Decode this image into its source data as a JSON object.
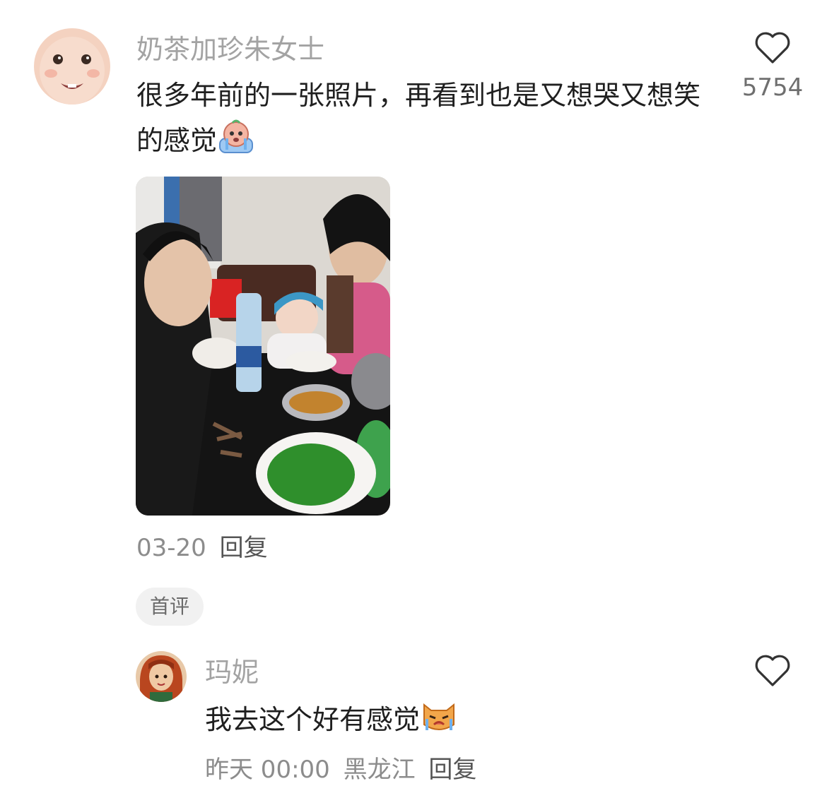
{
  "comment1": {
    "username": "奶茶加珍朱女士",
    "text": "很多年前的一张照片，再看到也是又想哭又想笑的感觉",
    "emoji": "crying-face-emoji",
    "like_count": "5754",
    "date": "03-20",
    "reply_label": "回复",
    "photo": "family-dinner-photo"
  },
  "badge": {
    "label": "首评"
  },
  "comment2": {
    "username": "玛妮",
    "text": "我去这个好有感觉",
    "emoji": "crying-cat-emoji",
    "time": "昨天 00:00",
    "location": "黑龙江",
    "reply_label": "回复"
  }
}
